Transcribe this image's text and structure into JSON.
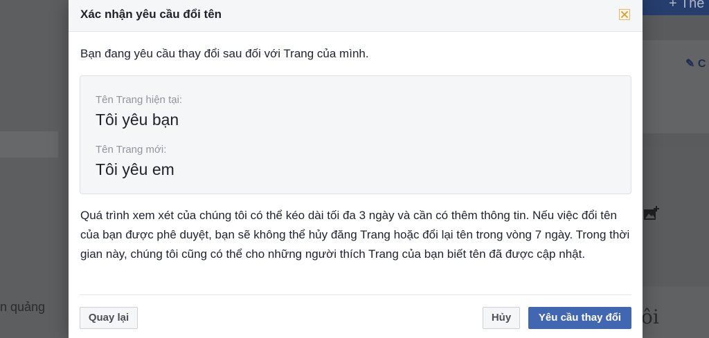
{
  "background": {
    "left_text": "n quảng",
    "right_top_text": "+ The",
    "right_edit_text": "✎ C",
    "right_bottom_text": "ôi"
  },
  "dialog": {
    "title": "Xác nhận yêu cầu đổi tên",
    "intro": "Bạn đang yêu cầu thay đổi sau đối với Trang của mình.",
    "current_name_label": "Tên Trang hiện tại:",
    "current_name": "Tôi yêu bạn",
    "new_name_label": "Tên Trang mới:",
    "new_name": "Tôi yêu em",
    "description": "Quá trình xem xét của chúng tôi có thể kéo dài tối đa 3 ngày và cần có thêm thông tin. Nếu việc đổi tên của bạn được phê duyệt, bạn sẽ không thể hủy đăng Trang hoặc đổi lại tên trong vòng 7 ngày. Trong thời gian này, chúng tôi cũng có thể cho những người thích Trang của bạn biết tên đã được cập nhật.",
    "back_label": "Quay lại",
    "cancel_label": "Hủy",
    "confirm_label": "Yêu cầu thay đổi"
  },
  "colors": {
    "primary_button": "#4267b2",
    "overlay": "#5f6062",
    "close_border": "#e9b765"
  },
  "icons": [
    "close-icon",
    "photo-add-icon",
    "pencil-icon"
  ]
}
